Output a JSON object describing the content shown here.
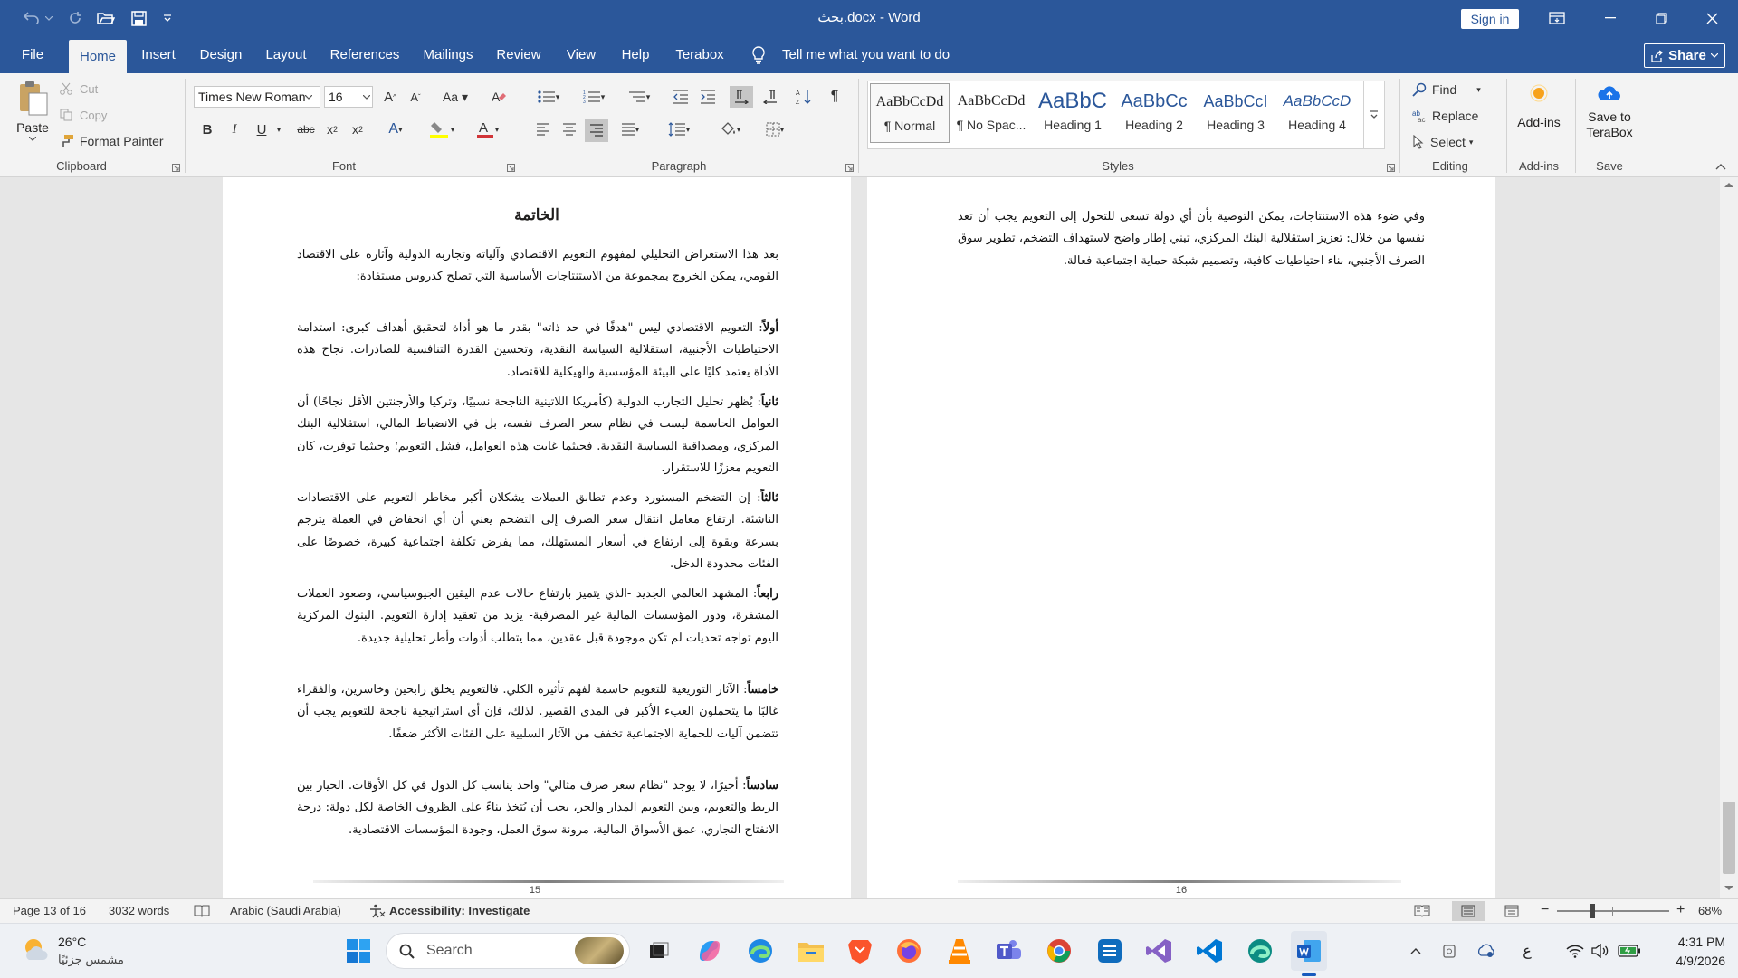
{
  "window": {
    "title": "بحث.docx - Word",
    "sign_in": "Sign in"
  },
  "tabs": [
    "File",
    "Home",
    "Insert",
    "Design",
    "Layout",
    "References",
    "Mailings",
    "Review",
    "View",
    "Help",
    "Terabox"
  ],
  "tell_me": "Tell me what you want to do",
  "share": "Share",
  "clipboard": {
    "paste": "Paste",
    "cut": "Cut",
    "copy": "Copy",
    "format_painter": "Format Painter",
    "label": "Clipboard"
  },
  "font": {
    "name": "Times New Roman",
    "size": "16",
    "label": "Font"
  },
  "paragraph_label": "Paragraph",
  "styles": {
    "label": "Styles",
    "items": [
      {
        "preview": "AaBbCcDd",
        "name": "¶ Normal"
      },
      {
        "preview": "AaBbCcDd",
        "name": "¶ No Spac..."
      },
      {
        "preview": "AaBbC",
        "name": "Heading 1"
      },
      {
        "preview": "AaBbCc",
        "name": "Heading 2"
      },
      {
        "preview": "AaBbCcI",
        "name": "Heading 3"
      },
      {
        "preview": "AaBbCcD",
        "name": "Heading 4"
      }
    ]
  },
  "editing": {
    "find": "Find",
    "replace": "Replace",
    "select": "Select",
    "label": "Editing"
  },
  "addins": {
    "button": "Add-ins",
    "label": "Add-ins"
  },
  "save_group": {
    "button_line1": "Save to",
    "button_line2": "TeraBox",
    "label": "Save"
  },
  "document": {
    "left_page": {
      "heading": "الخاتمة",
      "paragraphs": [
        {
          "lead": "",
          "text": "بعد هذا الاستعراض التحليلي لمفهوم التعويم الاقتصادي وآلياته وتجاربه الدولية وآثاره على الاقتصاد القومي، يمكن الخروج بمجموعة من الاستنتاجات الأساسية التي تصلح كدروس مستفادة:"
        },
        {
          "lead": "أولاً",
          "text": ": التعويم الاقتصادي ليس \"هدفًا في حد ذاته\" بقدر ما هو أداة لتحقيق أهداف كبرى: استدامة الاحتياطيات الأجنبية، استقلالية السياسة النقدية، وتحسين القدرة التنافسية للصادرات. نجاح هذه الأداة يعتمد كليًا على البيئة المؤسسية والهيكلية للاقتصاد."
        },
        {
          "lead": "ثانياً",
          "text": ": يُظهر تحليل التجارب الدولية (كأمريكا اللاتينية الناجحة نسبيًا، وتركيا والأرجنتين الأقل نجاحًا) أن العوامل الحاسمة ليست في نظام سعر الصرف نفسه، بل في الانضباط المالي، استقلالية البنك المركزي، ومصداقية السياسة النقدية. فحيثما غابت هذه العوامل، فشل التعويم؛ وحيثما توفرت، كان التعويم معززًا للاستقرار."
        },
        {
          "lead": "ثالثاً",
          "text": ": إن التضخم المستورد وعدم تطابق العملات يشكلان أكبر مخاطر التعويم على الاقتصادات الناشئة. ارتفاع معامل انتقال سعر الصرف إلى التضخم يعني أن أي انخفاض في العملة يترجم بسرعة وبقوة إلى ارتفاع في أسعار المستهلك، مما يفرض تكلفة اجتماعية كبيرة، خصوصًا على الفئات محدودة الدخل."
        },
        {
          "lead": "رابعاً",
          "text": ": المشهد العالمي الجديد -الذي يتميز بارتفاع حالات عدم اليقين الجيوسياسي، وصعود العملات المشفرة، ودور المؤسسات المالية غير المصرفية- يزيد من تعقيد إدارة التعويم. البنوك المركزية اليوم تواجه تحديات لم تكن موجودة قبل عقدين، مما يتطلب أدوات وأطر تحليلية جديدة."
        },
        {
          "lead": "خامساً",
          "text": ": الآثار التوزيعية للتعويم حاسمة لفهم تأثيره الكلي. فالتعويم يخلق رابحين وخاسرين، والفقراء غالبًا ما يتحملون العبء الأكبر في المدى القصير. لذلك، فإن أي استراتيجية ناجحة للتعويم يجب أن تتضمن آليات للحماية الاجتماعية تخفف من الآثار السلبية على الفئات الأكثر ضعفًا."
        },
        {
          "lead": "سادساً",
          "text": ": أخيرًا، لا يوجد \"نظام سعر صرف مثالي\" واحد يناسب كل الدول في كل الأوقات. الخيار بين الربط والتعويم، وبين التعويم المدار والحر، يجب أن يُتخذ بناءً على الظروف الخاصة لكل دولة: درجة الانفتاح التجاري، عمق الأسواق المالية، مرونة سوق العمل، وجودة المؤسسات الاقتصادية."
        }
      ],
      "page_number": "15"
    },
    "right_page": {
      "paragraph": "وفي ضوء هذه الاستنتاجات، يمكن التوصية بأن أي دولة تسعى للتحول إلى التعويم يجب أن تعد نفسها من خلال: تعزيز استقلالية البنك المركزي، تبني إطار واضح لاستهداف التضخم، تطوير سوق الصرف الأجنبي، بناء احتياطيات كافية، وتصميم شبكة حماية اجتماعية فعالة.",
      "page_number": "16"
    }
  },
  "status": {
    "page": "Page 13 of 16",
    "words": "3032 words",
    "language": "Arabic (Saudi Arabia)",
    "accessibility": "Accessibility: Investigate",
    "zoom": "68%",
    "zoom_fraction": 0.68
  },
  "taskbar": {
    "temperature": "26°C",
    "weather": "مشمس جزئيًا",
    "search": "Search",
    "ime": "ع",
    "time": "4:31 PM",
    "date": "4/9/2026"
  },
  "colors": {
    "word_blue": "#2b579a",
    "ribbon_bg": "#f3f3f3",
    "font_red": "#d13438",
    "highlight_yellow": "#ffff00"
  }
}
